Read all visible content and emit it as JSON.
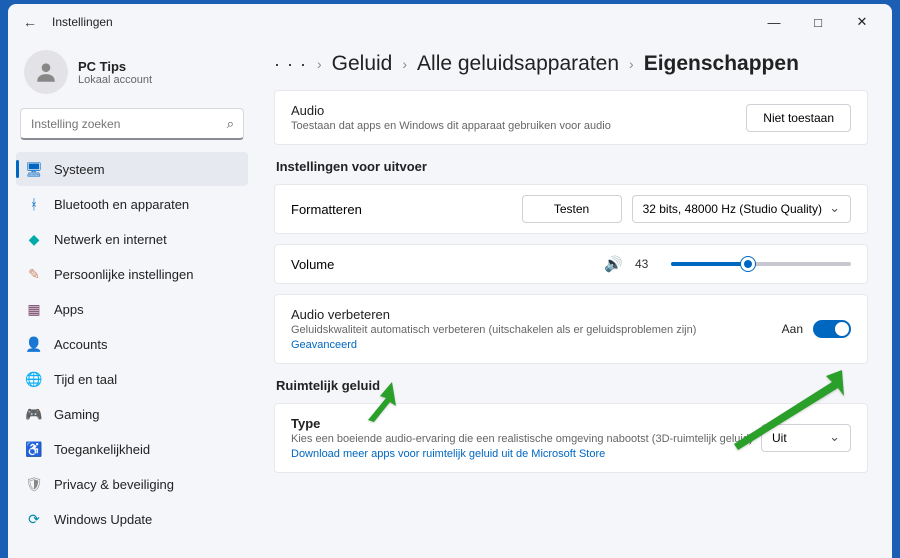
{
  "window": {
    "title": "Instellingen"
  },
  "user": {
    "name": "PC Tips",
    "sub": "Lokaal account"
  },
  "search": {
    "placeholder": "Instelling zoeken"
  },
  "nav": [
    {
      "key": "systeem",
      "label": "Systeem",
      "color": "#0067c0",
      "glyph": "🖥"
    },
    {
      "key": "bluetooth",
      "label": "Bluetooth en apparaten",
      "color": "#0067c0",
      "glyph": "ᚼ"
    },
    {
      "key": "netwerk",
      "label": "Netwerk en internet",
      "color": "#0aa",
      "glyph": "◆"
    },
    {
      "key": "persoonlijk",
      "label": "Persoonlijke instellingen",
      "color": "#c86",
      "glyph": "✎"
    },
    {
      "key": "apps",
      "label": "Apps",
      "color": "#746",
      "glyph": "▦"
    },
    {
      "key": "accounts",
      "label": "Accounts",
      "color": "#3a8",
      "glyph": "👤"
    },
    {
      "key": "tijd",
      "label": "Tijd en taal",
      "color": "#08a",
      "glyph": "🌐"
    },
    {
      "key": "gaming",
      "label": "Gaming",
      "color": "#5a5",
      "glyph": "🎮"
    },
    {
      "key": "toegankelijkheid",
      "label": "Toegankelijkheid",
      "color": "#08a",
      "glyph": "♿"
    },
    {
      "key": "privacy",
      "label": "Privacy & beveiliging",
      "color": "#888",
      "glyph": "🛡"
    },
    {
      "key": "update",
      "label": "Windows Update",
      "color": "#08a",
      "glyph": "⟳"
    }
  ],
  "breadcrumb": {
    "dots": "· · ·",
    "a": "Geluid",
    "b": "Alle geluidsapparaten",
    "current": "Eigenschappen"
  },
  "audioCard": {
    "title": "Audio",
    "sub": "Toestaan dat apps en Windows dit apparaat gebruiken voor audio",
    "btn": "Niet toestaan"
  },
  "sectionOut": "Instellingen voor uitvoer",
  "format": {
    "label": "Formatteren",
    "test": "Testen",
    "value": "32 bits, 48000 Hz (Studio Quality)"
  },
  "volume": {
    "label": "Volume",
    "value": 43
  },
  "enhance": {
    "title": "Audio verbeteren",
    "sub": "Geluidskwaliteit automatisch verbeteren (uitschakelen als er geluidsproblemen zijn)",
    "advanced": "Geavanceerd",
    "state": "Aan"
  },
  "sectionSpatial": "Ruimtelijk geluid",
  "spatial": {
    "title": "Type",
    "sub": "Kies een boeiende audio-ervaring die een realistische omgeving nabootst (3D-ruimtelijk geluid)",
    "link": "Download meer apps voor ruimtelijk geluid uit de Microsoft Store",
    "value": "Uit"
  }
}
